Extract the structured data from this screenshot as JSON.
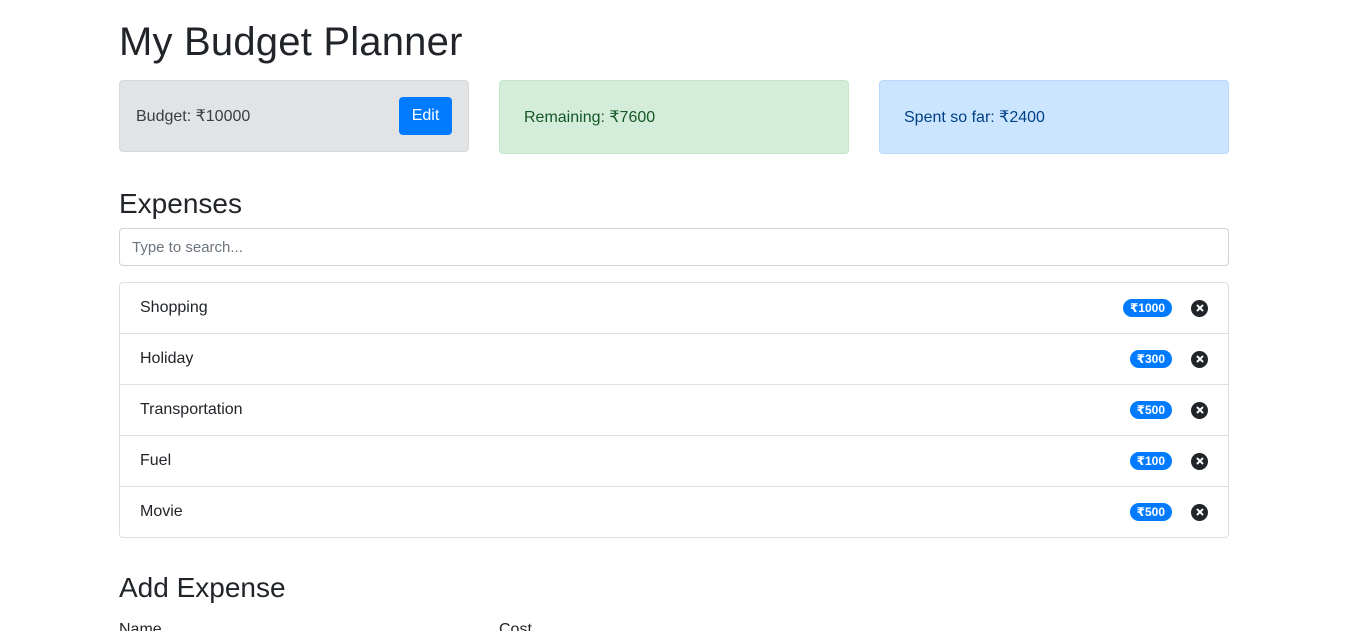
{
  "app": {
    "title": "My Budget Planner"
  },
  "summary": {
    "budget_text": "Budget: ₹10000",
    "edit_label": "Edit",
    "remaining_text": "Remaining: ₹7600",
    "spent_text": "Spent so far: ₹2400"
  },
  "expenses": {
    "heading": "Expenses",
    "search_placeholder": "Type to search...",
    "items": [
      {
        "name": "Shopping",
        "cost": "₹1000"
      },
      {
        "name": "Holiday",
        "cost": "₹300"
      },
      {
        "name": "Transportation",
        "cost": "₹500"
      },
      {
        "name": "Fuel",
        "cost": "₹100"
      },
      {
        "name": "Movie",
        "cost": "₹500"
      }
    ]
  },
  "add_expense": {
    "heading": "Add Expense",
    "name_label": "Name",
    "cost_label": "Cost"
  },
  "colors": {
    "accent": "#007bff",
    "budget_bg": "#e2e3e5",
    "remaining_bg": "#d4edda",
    "spent_bg": "#cce5ff"
  },
  "icons": {
    "delete": "close-circle-icon"
  }
}
